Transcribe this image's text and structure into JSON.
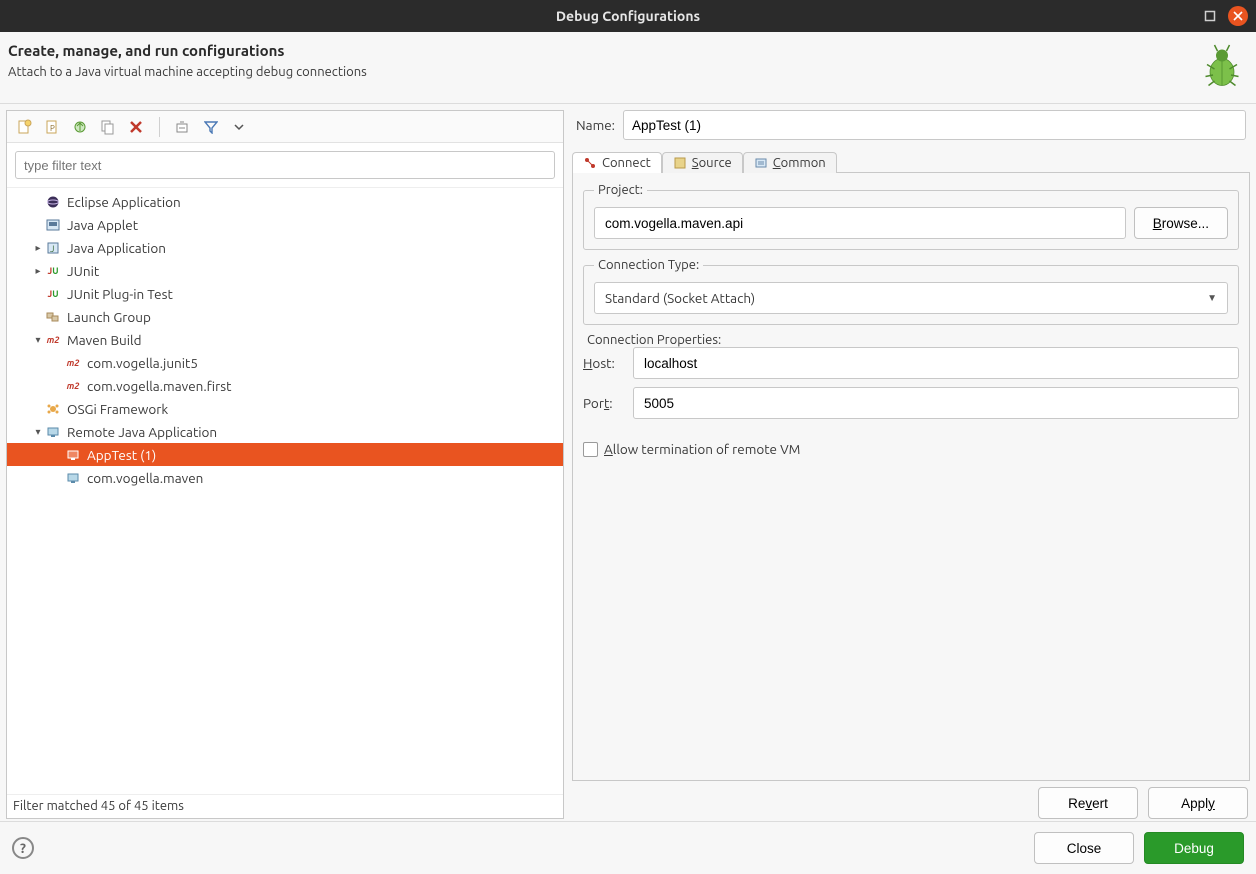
{
  "window": {
    "title": "Debug Configurations"
  },
  "header": {
    "title": "Create, manage, and run configurations",
    "subtitle": "Attach to a Java virtual machine accepting debug connections"
  },
  "filter": {
    "placeholder": "type filter text"
  },
  "tree": {
    "items": [
      {
        "label": "Eclipse Application",
        "indent": 1,
        "twisty": "",
        "icon": "eclipse-icon"
      },
      {
        "label": "Java Applet",
        "indent": 1,
        "twisty": "",
        "icon": "applet-icon"
      },
      {
        "label": "Java Application",
        "indent": 1,
        "twisty": "▸",
        "icon": "java-app-icon"
      },
      {
        "label": "JUnit",
        "indent": 1,
        "twisty": "▸",
        "icon": "junit-icon"
      },
      {
        "label": "JUnit Plug-in Test",
        "indent": 1,
        "twisty": "",
        "icon": "junit-plugin-icon"
      },
      {
        "label": "Launch Group",
        "indent": 1,
        "twisty": "",
        "icon": "launch-group-icon"
      },
      {
        "label": "Maven Build",
        "indent": 1,
        "twisty": "▾",
        "icon": "maven-icon"
      },
      {
        "label": "com.vogella.junit5",
        "indent": 2,
        "twisty": "",
        "icon": "maven-icon"
      },
      {
        "label": "com.vogella.maven.first",
        "indent": 2,
        "twisty": "",
        "icon": "maven-icon"
      },
      {
        "label": "OSGi Framework",
        "indent": 1,
        "twisty": "",
        "icon": "osgi-icon"
      },
      {
        "label": "Remote Java Application",
        "indent": 1,
        "twisty": "▾",
        "icon": "remote-java-icon"
      },
      {
        "label": "AppTest (1)",
        "indent": 2,
        "twisty": "",
        "icon": "remote-config-icon",
        "selected": true
      },
      {
        "label": "com.vogella.maven",
        "indent": 2,
        "twisty": "",
        "icon": "remote-config-icon"
      }
    ]
  },
  "status": "Filter matched 45 of 45 items",
  "form": {
    "name_label": "Name:",
    "name_value": "AppTest (1)",
    "tabs": {
      "connect": "Connect",
      "source": "Source",
      "common": "Common"
    },
    "project": {
      "legend": "Project:",
      "value": "com.vogella.maven.api",
      "browse": "Browse..."
    },
    "conn_type": {
      "legend": "Connection Type:",
      "value": "Standard (Socket Attach)"
    },
    "conn_props": {
      "legend": "Connection Properties:",
      "host_label": "Host:",
      "host_value": "localhost",
      "port_label": "Port:",
      "port_value": "5005"
    },
    "allow_term": "Allow termination of remote VM",
    "revert": "Revert",
    "apply": "Apply"
  },
  "footer": {
    "close": "Close",
    "debug": "Debug"
  }
}
